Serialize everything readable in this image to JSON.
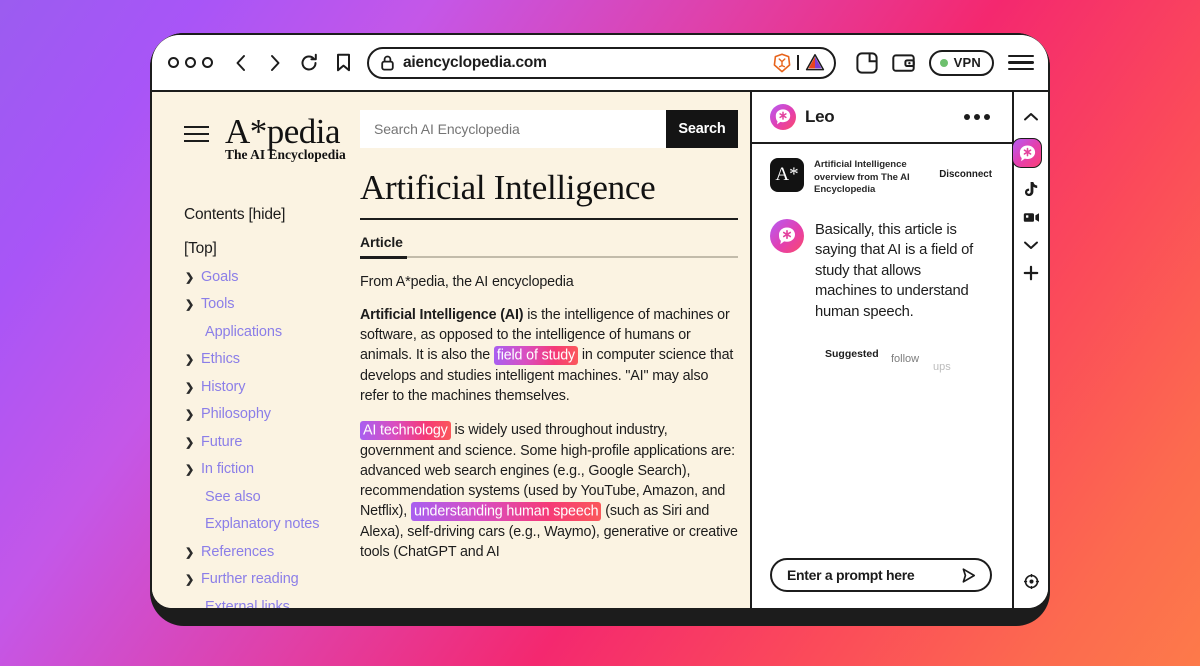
{
  "browser": {
    "window_dots": 3,
    "nav": {
      "back": "back-arrow",
      "forward": "forward-arrow",
      "reload": "reload",
      "bookmark": "bookmark"
    },
    "url": "aiencyclopedia.com",
    "lock_icon": "lock-icon",
    "shields_icon": "brave-lion-icon",
    "rewards_icon": "brave-bat-triangle-icon",
    "sidebar_icon": "sidebar-panel-icon",
    "wallet_icon": "wallet-icon",
    "vpn_label": "VPN",
    "vpn_status_color": "#6ec06e",
    "menu_icon": "hamburger-menu-icon"
  },
  "wiki": {
    "brand_title": "A*pedia",
    "brand_subtitle": "The AI Encyclopedia",
    "menu_icon": "hamburger-menu-icon",
    "search": {
      "placeholder": "Search AI Encyclopedia",
      "value": "",
      "button_label": "Search"
    },
    "contents_heading": "Contents [hide]",
    "toc_top": "[Top]",
    "toc": [
      {
        "label": "Goals",
        "expandable": true
      },
      {
        "label": "Tools",
        "expandable": true
      },
      {
        "label": "Applications",
        "expandable": false
      },
      {
        "label": "Ethics",
        "expandable": true
      },
      {
        "label": "History",
        "expandable": true
      },
      {
        "label": "Philosophy",
        "expandable": true
      },
      {
        "label": "Future",
        "expandable": true
      },
      {
        "label": "In fiction",
        "expandable": true
      },
      {
        "label": "See also",
        "expandable": false
      },
      {
        "label": "Explanatory notes",
        "expandable": false
      },
      {
        "label": "References",
        "expandable": true
      },
      {
        "label": "Further reading",
        "expandable": true
      },
      {
        "label": "External links",
        "expandable": false
      }
    ],
    "page_title": "Artificial Intelligence",
    "tab_article": "Article",
    "from_line": "From A*pedia, the AI encyclopedia",
    "para1": {
      "bold_lead": "Artificial Intelligence (AI)",
      "part_a": " is the intelligence of machines or software, as opposed to the intelligence of humans or animals. It is also the ",
      "highlight_a": "field of study",
      "part_b": " in computer science that develops and studies intelligent machines. \"AI\" may also refer to the machines themselves."
    },
    "para2": {
      "highlight_a": "AI technology",
      "part_a": " is widely used throughout industry, government and science. Some high-profile applications are: advanced web search engines (e.g., Google Search), recommendation systems (used by YouTube, Amazon, and Netflix), ",
      "highlight_b": "understanding human speech",
      "part_b": " (such as Siri and Alexa), self-driving cars (e.g., Waymo), generative or creative tools (ChatGPT and AI"
    },
    "highlight_gradient": [
      "#a95ff0",
      "#f53a78",
      "#fb585a"
    ]
  },
  "leo": {
    "title": "Leo",
    "avatar_icon": "leo-asterisk-bubble-icon",
    "more_icon": "more-options-icon",
    "context": {
      "logo_text": "A*",
      "description": "Artificial Intelligence overview from The AI Encyclopedia",
      "action_label": "Disconnect"
    },
    "message": "Basically, this article is saying that AI is a field of study that allows machines to understand human speech.",
    "suggested": {
      "word1": "Suggested",
      "word2": "follow",
      "word3": "ups"
    },
    "prompt": {
      "placeholder": "Enter a prompt here",
      "value": "",
      "send_icon": "send-arrow-icon"
    },
    "accent_gradient": [
      "#b65cf5",
      "#e33fb0",
      "#fb4a6a"
    ]
  },
  "rail": {
    "items": [
      {
        "name": "chevron-up-icon",
        "active": false
      },
      {
        "name": "leo-asterisk-bubble-icon",
        "active": true
      },
      {
        "name": "tiktok-icon",
        "active": false
      },
      {
        "name": "video-icon",
        "active": false
      },
      {
        "name": "chevron-down-icon",
        "active": false
      },
      {
        "name": "plus-icon",
        "active": false
      }
    ],
    "settings_icon": "settings-gear-icon"
  }
}
